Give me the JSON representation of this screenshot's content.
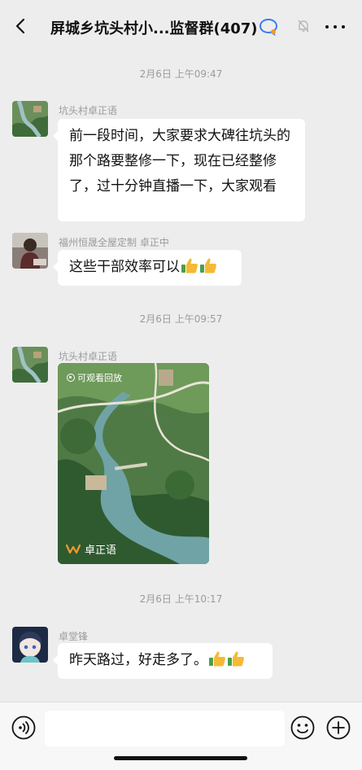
{
  "header": {
    "title": "屏城乡坑头村小...监督群(407)",
    "back_icon": "chevron-left-icon",
    "more_icon": "more-icon"
  },
  "messages": [
    {
      "type": "time",
      "text": "2月6日 上午09:47"
    },
    {
      "type": "text",
      "sender": "坑头村卓正语",
      "text": "前一段时间，大家要求大碑往坑头的那个路要整修一下，现在已经整修了，过十分钟直播一下，大家观看"
    },
    {
      "type": "text",
      "sender": "福州恒晟全屋定制 卓正中",
      "text": "这些干部效率可以"
    },
    {
      "type": "time",
      "text": "2月6日 上午09:57"
    },
    {
      "type": "video",
      "sender": "坑头村卓正语",
      "replay_label": "可观看回放",
      "channel": "卓正语"
    },
    {
      "type": "time",
      "text": "2月6日 上午10:17"
    },
    {
      "type": "text",
      "sender": "卓堂锋",
      "text": "昨天路过，好走多了。"
    }
  ],
  "input": {
    "placeholder": ""
  },
  "colors": {
    "background": "#ededed",
    "bubble": "#ffffff",
    "time_text": "#9b9b9b",
    "accent_channels": "#f29b2a"
  }
}
